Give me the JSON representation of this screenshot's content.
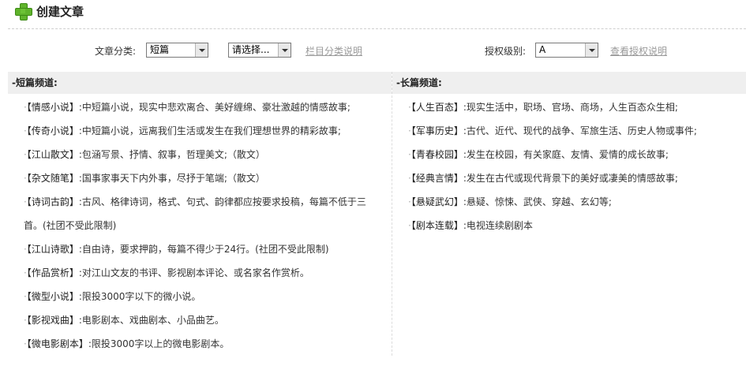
{
  "header": {
    "title": "创建文章",
    "icon": "plus-icon"
  },
  "filters": {
    "category_label": "文章分类:",
    "category_value": "短篇",
    "subcategory_value": "请选择...",
    "category_help_link": "栏目分类说明",
    "auth_label": "授权级别:",
    "auth_value": "A",
    "auth_help_link": "查看授权说明"
  },
  "short_channel": {
    "title": "-短篇频道:",
    "items": [
      {
        "tag": "【情感小说】",
        "desc": ":中短篇小说，现实中悲欢离合、美好缠绵、豪壮激越的情感故事;"
      },
      {
        "tag": "【传奇小说】",
        "desc": ":中短篇小说，远离我们生活或发生在我们理想世界的精彩故事;"
      },
      {
        "tag": "【江山散文】",
        "desc": ":包涵写景、抒情、叙事，哲理美文;（散文）"
      },
      {
        "tag": "【杂文随笔】",
        "desc": ":国事家事天下内外事，尽抒于笔端;（散文）"
      },
      {
        "tag": "【诗词古韵】",
        "desc": ":古风、格律诗词，格式、句式、韵律都应按要求投稿，每篇不低于三",
        "cont": "首。(社团不受此限制)"
      },
      {
        "tag": "【江山诗歌】",
        "desc": ":自由诗，要求押韵，每篇不得少于24行。(社团不受此限制)"
      },
      {
        "tag": "【作品赏析】",
        "desc": ":对江山文友的书评、影视剧本评论、或名家名作赏析。"
      },
      {
        "tag": "【微型小说】",
        "desc": ":限投3000字以下的微小说。"
      },
      {
        "tag": "【影视戏曲】",
        "desc": ":电影剧本、戏曲剧本、小品曲艺。"
      },
      {
        "tag": "【微电影剧本】",
        "desc": ":限投3000字以上的微电影剧本。"
      }
    ]
  },
  "long_channel": {
    "title": "-长篇频道:",
    "items": [
      {
        "tag": "【人生百态】",
        "desc": ":现实生活中，职场、官场、商场，人生百态众生相;"
      },
      {
        "tag": "【军事历史】",
        "desc": ":古代、近代、现代的战争、军旅生活、历史人物或事件;"
      },
      {
        "tag": "【青春校园】",
        "desc": ":发生在校园，有关家庭、友情、爱情的成长故事;"
      },
      {
        "tag": "【经典言情】",
        "desc": ":发生在古代或现代背景下的美好或凄美的情感故事;"
      },
      {
        "tag": "【悬疑武幻】",
        "desc": ":悬疑、惊悚、武侠、穿越、玄幻等;"
      },
      {
        "tag": "【剧本连载】",
        "desc": ":电视连续剧剧本"
      }
    ]
  }
}
